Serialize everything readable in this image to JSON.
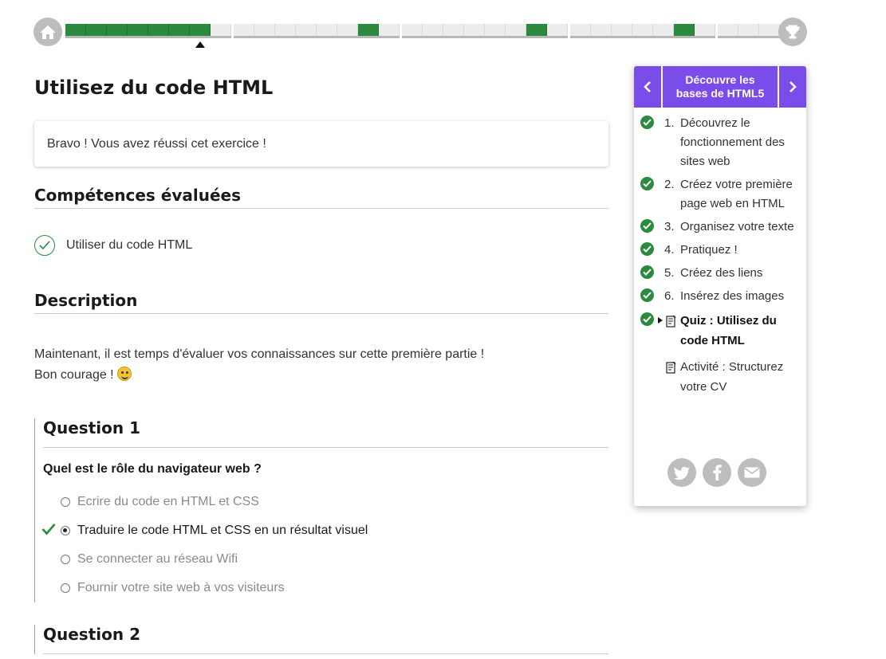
{
  "progress": {
    "groups": [
      [
        1,
        1,
        1,
        1,
        1,
        1,
        1,
        0
      ],
      [
        0,
        0,
        0,
        0,
        0,
        0,
        1,
        0
      ],
      [
        0,
        0,
        0,
        0,
        0,
        0,
        1,
        0
      ],
      [
        0,
        0,
        0,
        0,
        0,
        1,
        0
      ],
      [
        0,
        0,
        0
      ]
    ]
  },
  "page": {
    "title": "Utilisez du code HTML",
    "success_message": "Bravo ! Vous avez réussi cet exercice !",
    "skills_heading": "Compétences évaluées",
    "skills": [
      "Utiliser du code HTML"
    ],
    "description_heading": "Description",
    "description_line1": "Maintenant, il est temps d'évaluer vos connaissances sur cette première partie !",
    "description_line2": "Bon courage !"
  },
  "questions": [
    {
      "heading": "Question 1",
      "text": "Quel est le rôle du navigateur web ?",
      "options": [
        "Ecrire du code en HTML et CSS",
        "Traduire le code HTML et CSS en un résultat visuel",
        "Se connecter au réseau Wifi",
        "Fournir votre site web à vos visiteurs"
      ],
      "selected_index": 1
    },
    {
      "heading": "Question 2"
    }
  ],
  "sidebar": {
    "title": "Découvre les bases de HTML5",
    "chapters": [
      {
        "num": "1.",
        "label": "Découvrez le fonctionnement des sites web"
      },
      {
        "num": "2.",
        "label": "Créez votre première page web en HTML"
      },
      {
        "num": "3.",
        "label": "Organisez votre texte"
      },
      {
        "num": "4.",
        "label": "Pratiquez !"
      },
      {
        "num": "5.",
        "label": "Créez des liens"
      },
      {
        "num": "6.",
        "label": "Insérez des images"
      }
    ],
    "current_item": "Quiz : Utilisez du code HTML",
    "activity_item": "Activité : Structurez votre CV"
  },
  "colors": {
    "accent": "#7a4dea",
    "success": "#2b8a3e",
    "gray": "#bdbdbd"
  }
}
